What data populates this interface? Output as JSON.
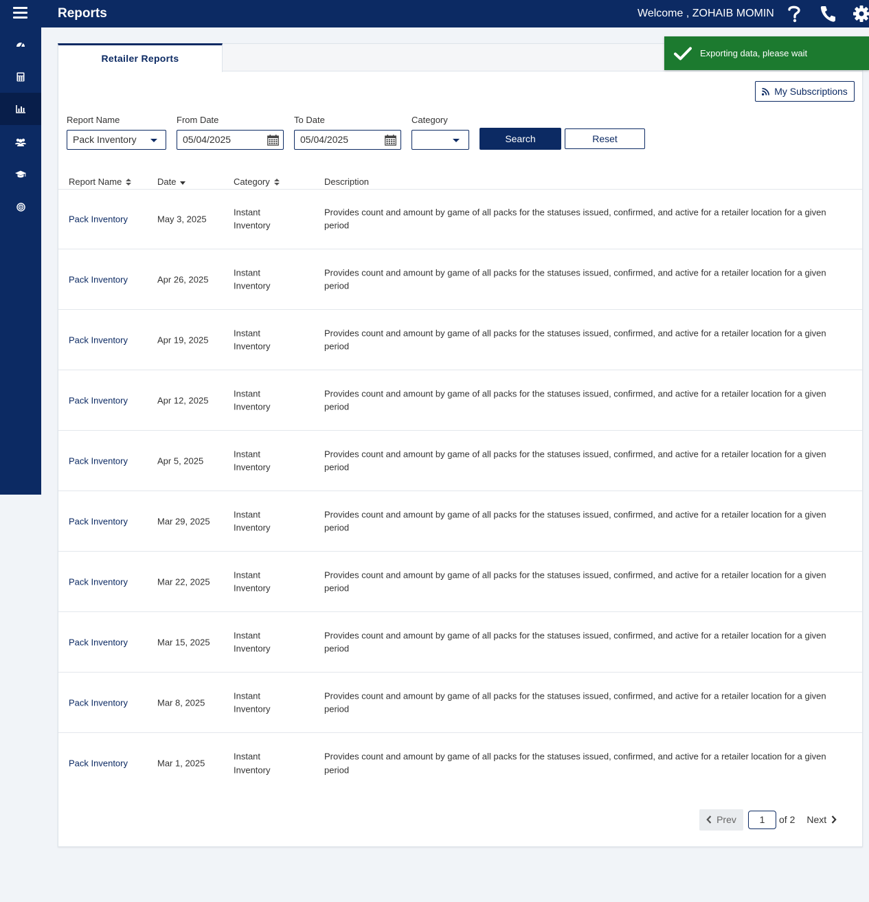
{
  "header": {
    "title": "Reports",
    "welcome": "Welcome , ZOHAIB MOMIN"
  },
  "sidebar": {
    "items": [
      {
        "icon": "dashboard-icon",
        "active": false
      },
      {
        "icon": "calculator-icon",
        "active": false
      },
      {
        "icon": "bar-chart-icon",
        "active": true
      },
      {
        "icon": "users-icon",
        "active": false
      },
      {
        "icon": "graduation-cap-icon",
        "active": false
      },
      {
        "icon": "target-icon",
        "active": false
      }
    ]
  },
  "tabs": [
    {
      "label": "Retailer Reports",
      "active": true
    }
  ],
  "subscriptions_label": "My Subscriptions",
  "filters": {
    "report_name": {
      "label": "Report Name",
      "value": "Pack Inventory"
    },
    "from_date": {
      "label": "From Date",
      "value": "05/04/2025"
    },
    "to_date": {
      "label": "To Date",
      "value": "05/04/2025"
    },
    "category": {
      "label": "Category",
      "value": ""
    },
    "search_label": "Search",
    "reset_label": "Reset"
  },
  "table": {
    "columns": [
      "Report Name",
      "Date",
      "Category",
      "Description"
    ],
    "rows": [
      {
        "name": "Pack Inventory",
        "date": "May 3, 2025",
        "category": "Instant Inventory",
        "description": "Provides count and amount by game of all packs for the statuses issued, confirmed, and active for a retailer location for a given period"
      },
      {
        "name": "Pack Inventory",
        "date": "Apr 26, 2025",
        "category": "Instant Inventory",
        "description": "Provides count and amount by game of all packs for the statuses issued, confirmed, and active for a retailer location for a given period"
      },
      {
        "name": "Pack Inventory",
        "date": "Apr 19, 2025",
        "category": "Instant Inventory",
        "description": "Provides count and amount by game of all packs for the statuses issued, confirmed, and active for a retailer location for a given period"
      },
      {
        "name": "Pack Inventory",
        "date": "Apr 12, 2025",
        "category": "Instant Inventory",
        "description": "Provides count and amount by game of all packs for the statuses issued, confirmed, and active for a retailer location for a given period"
      },
      {
        "name": "Pack Inventory",
        "date": "Apr 5, 2025",
        "category": "Instant Inventory",
        "description": "Provides count and amount by game of all packs for the statuses issued, confirmed, and active for a retailer location for a given period"
      },
      {
        "name": "Pack Inventory",
        "date": "Mar 29, 2025",
        "category": "Instant Inventory",
        "description": "Provides count and amount by game of all packs for the statuses issued, confirmed, and active for a retailer location for a given period"
      },
      {
        "name": "Pack Inventory",
        "date": "Mar 22, 2025",
        "category": "Instant Inventory",
        "description": "Provides count and amount by game of all packs for the statuses issued, confirmed, and active for a retailer location for a given period"
      },
      {
        "name": "Pack Inventory",
        "date": "Mar 15, 2025",
        "category": "Instant Inventory",
        "description": "Provides count and amount by game of all packs for the statuses issued, confirmed, and active for a retailer location for a given period"
      },
      {
        "name": "Pack Inventory",
        "date": "Mar 8, 2025",
        "category": "Instant Inventory",
        "description": "Provides count and amount by game of all packs for the statuses issued, confirmed, and active for a retailer location for a given period"
      },
      {
        "name": "Pack Inventory",
        "date": "Mar 1, 2025",
        "category": "Instant Inventory",
        "description": "Provides count and amount by game of all packs for the statuses issued, confirmed, and active for a retailer location for a given period"
      }
    ]
  },
  "pagination": {
    "prev_label": "Prev",
    "current_page": "1",
    "of_label": "of 2",
    "next_label": "Next"
  },
  "toast": {
    "message": "Exporting data, please wait"
  },
  "colors": {
    "brand": "#0c2a63",
    "toast": "#1c7a2f",
    "background": "#f1f4f8"
  }
}
